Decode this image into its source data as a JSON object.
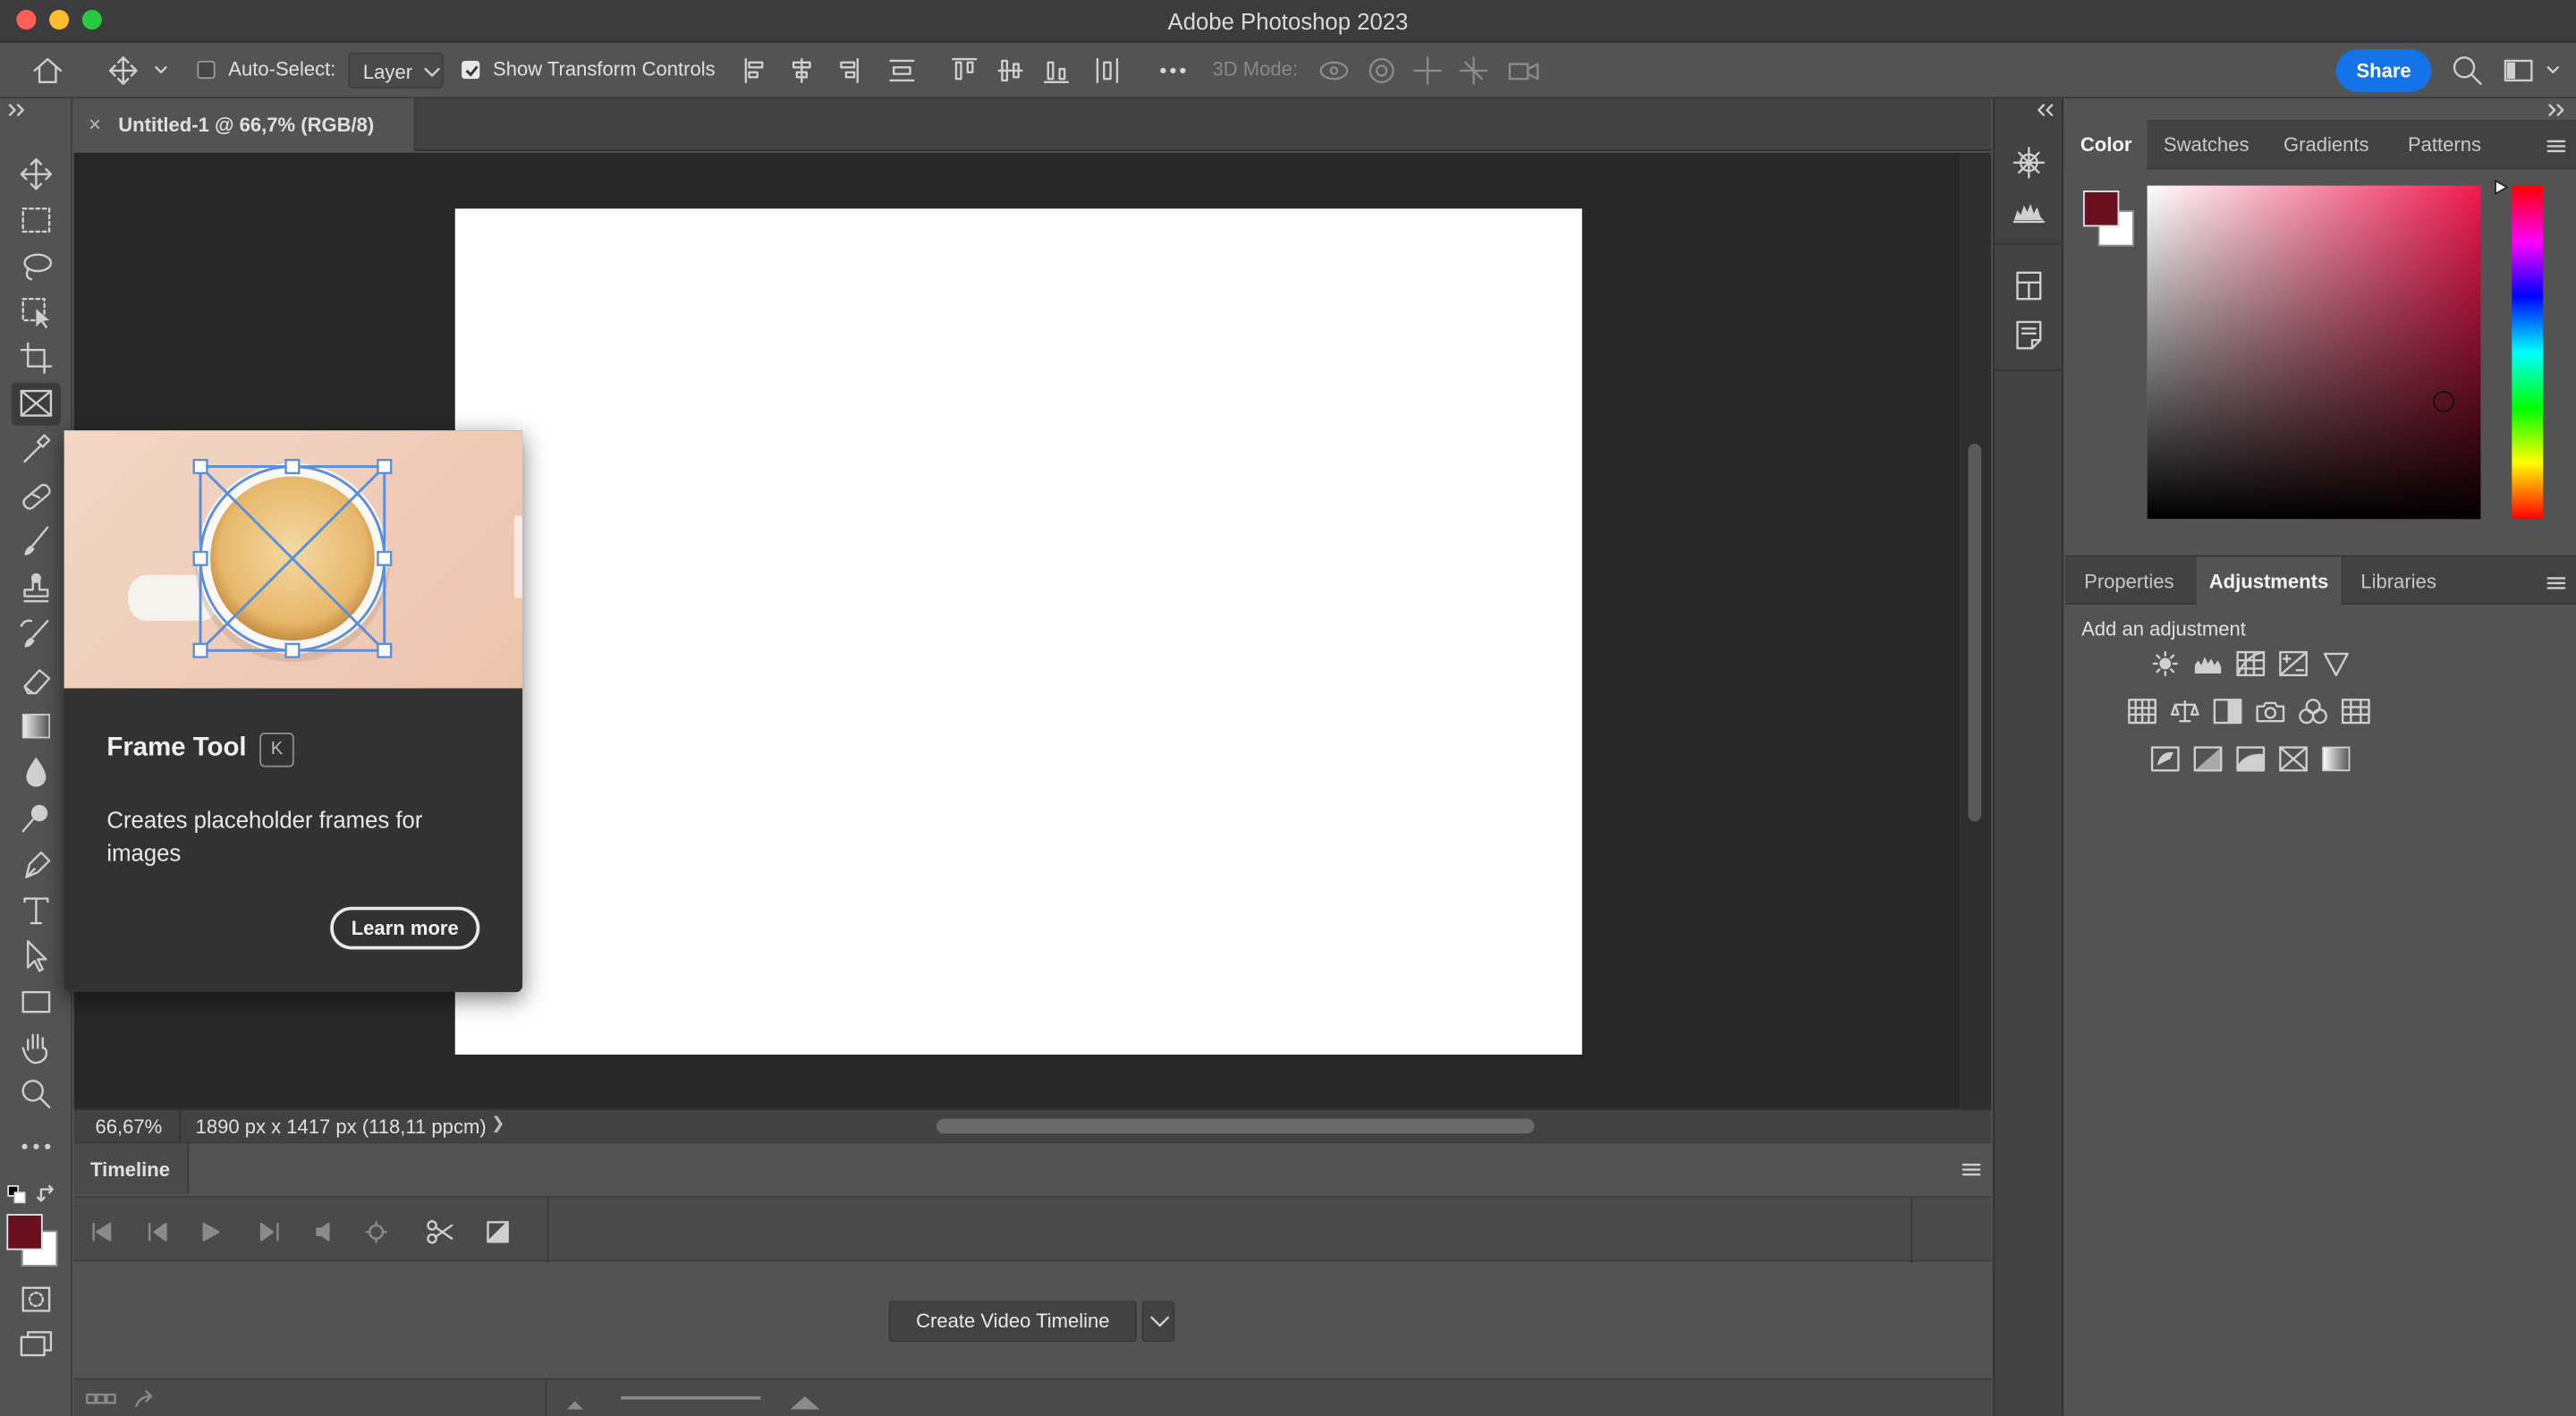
{
  "window": {
    "title": "Adobe Photoshop 2023"
  },
  "options_bar": {
    "auto_select_label": "Auto-Select:",
    "auto_select_target": "Layer",
    "show_transform_label": "Show Transform Controls",
    "mode_3d_label": "3D Mode:",
    "share_label": "Share"
  },
  "document": {
    "tab_title": "Untitled-1 @ 66,7% (RGB/8)",
    "close_glyph": "×",
    "zoom": "66,67%",
    "dimensions": "1890 px x 1417 px (118,11 ppcm)",
    "status_arrow": "❯"
  },
  "tooltip": {
    "title": "Frame Tool",
    "shortcut": "K",
    "description": "Creates placeholder frames for images",
    "learn_more": "Learn more"
  },
  "timeline": {
    "tab": "Timeline",
    "create_button": "Create Video Timeline"
  },
  "panels": {
    "top_tabs": [
      "Color",
      "Swatches",
      "Gradients",
      "Patterns"
    ],
    "bottom_tabs": [
      "Properties",
      "Adjustments",
      "Libraries"
    ],
    "adjustments_heading": "Add an adjustment"
  },
  "colors": {
    "foreground": "#6a0f1e",
    "background": "#ffffff",
    "accent": "#1473e6"
  },
  "icons": {
    "tools": [
      "move-icon",
      "marquee-icon",
      "lasso-icon",
      "object-select-icon",
      "crop-icon",
      "frame-icon",
      "eyedropper-icon",
      "healing-brush-icon",
      "brush-icon",
      "clone-stamp-icon",
      "history-brush-icon",
      "eraser-icon",
      "gradient-icon",
      "blur-icon",
      "dodge-icon",
      "pen-icon",
      "type-icon",
      "path-select-icon",
      "rectangle-icon",
      "hand-icon",
      "zoom-icon",
      "more-tools-icon"
    ]
  }
}
